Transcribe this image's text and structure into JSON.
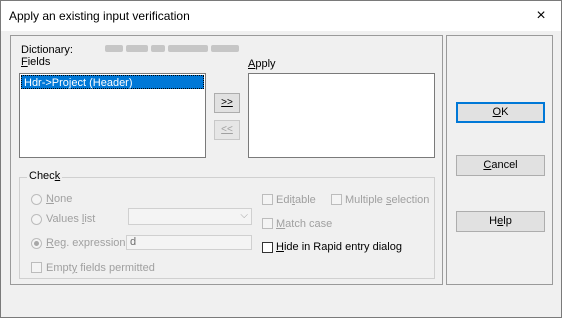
{
  "window": {
    "title": "Apply an existing input verification",
    "close_glyph": "×"
  },
  "dictionary": {
    "label": "Dictionary:",
    "value_redacted": true
  },
  "fields": {
    "label_prefix": "",
    "label_u": "F",
    "label_rest": "ields",
    "items": [
      "Hdr->Project (Header)"
    ],
    "selected_index": 0
  },
  "apply": {
    "label_u": "A",
    "label_rest": "pply",
    "items": []
  },
  "move": {
    "add_label": ">>",
    "remove_label": "<<"
  },
  "buttons": {
    "ok_pre": "",
    "ok_u": "O",
    "ok_rest": "K",
    "cancel_pre": "",
    "cancel_u": "C",
    "cancel_rest": "ancel",
    "help_pre": "H",
    "help_u": "e",
    "help_rest": "lp"
  },
  "check": {
    "label_pre": "Chec",
    "label_u": "k",
    "label_rest": "",
    "none_u": "N",
    "none_rest": "one",
    "values_pre": "Values ",
    "values_u": "l",
    "values_rest": "ist",
    "values_selected": "",
    "reg_u": "R",
    "reg_rest": "eg. expression",
    "reg_value": "d",
    "empty_pre": "Empt",
    "empty_u": "y",
    "empty_rest": " fields permitted",
    "editable_pre": "Edi",
    "editable_u": "t",
    "editable_rest": "able",
    "multiple_pre": "Multiple ",
    "multiple_u": "s",
    "multiple_rest": "election",
    "match_u": "M",
    "match_rest": "atch case",
    "hide_u": "H",
    "hide_rest": "ide in Rapid entry dialog",
    "selected_radio": "reg"
  }
}
